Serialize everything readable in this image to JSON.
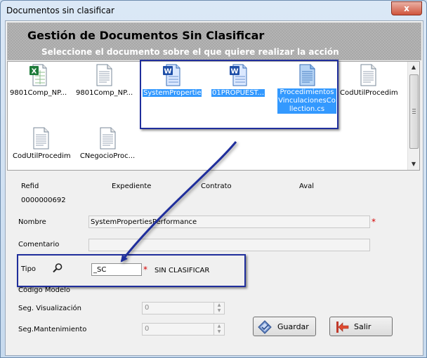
{
  "window": {
    "title": "Documentos sin clasificar",
    "close": "x"
  },
  "header": {
    "title": "Gestión de Documentos Sin Clasificar",
    "subtitle": "Seleccione el documento sobre el que quiere realizar la acción"
  },
  "files": [
    {
      "label": "9801Comp_NP...",
      "type": "excel",
      "selected": false
    },
    {
      "label": "9801Comp_NP...",
      "type": "text",
      "selected": false
    },
    {
      "label": "SystemPropertie...",
      "type": "word",
      "selected": true
    },
    {
      "label": "01PROPUEST...",
      "type": "word",
      "selected": true
    },
    {
      "label": "ProcedimientosVinculacionesCollection.cs",
      "type": "text-blue",
      "selected": true
    },
    {
      "label": "CodUtilProcedimi...",
      "type": "text",
      "selected": false
    },
    {
      "label": "CodUtilProcedim...",
      "type": "text",
      "selected": false
    },
    {
      "label": "CNegocioProc...",
      "type": "text",
      "selected": false
    }
  ],
  "info": {
    "refid_label": "Refid",
    "expediente_label": "Expediente",
    "contrato_label": "Contrato",
    "aval_label": "Aval",
    "refid_value": "0000000692"
  },
  "form": {
    "nombre_label": "Nombre",
    "nombre_value": "SystemPropertiesPerformance",
    "comentario_label": "Comentario",
    "comentario_value": "",
    "tipo_label": "Tipo",
    "tipo_value": "_SC",
    "tipo_desc": "SIN CLASIFICAR",
    "codigo_modelo_label": "Código Modelo",
    "seg_vis_label": "Seg. Visualización",
    "seg_vis_value": "0",
    "seg_mant_label": "Seg.Mantenimiento",
    "seg_mant_value": "0",
    "required_mark": "*"
  },
  "buttons": {
    "guardar": "Guardar",
    "salir": "Salir"
  },
  "colors": {
    "selection": "#3399ff",
    "highlight_box": "#1f2e9c",
    "required": "#d40000"
  }
}
